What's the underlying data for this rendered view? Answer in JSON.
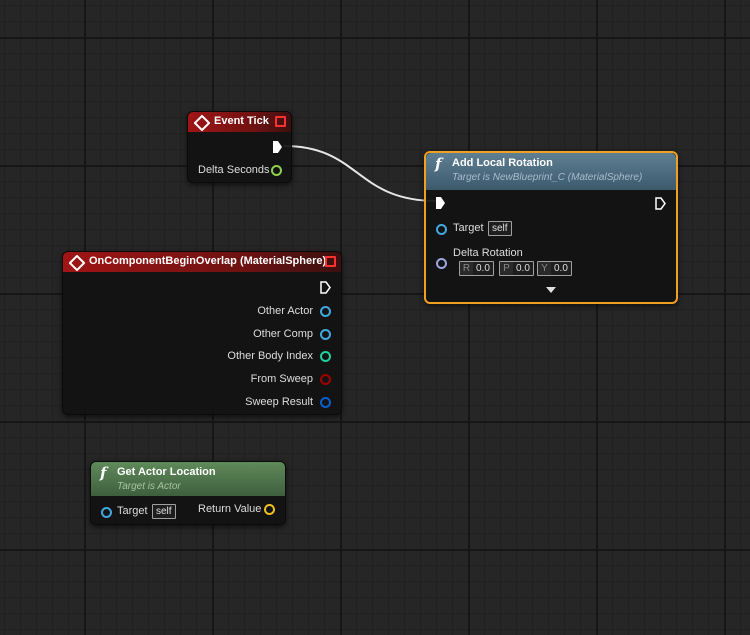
{
  "event_tick": {
    "title": "Event Tick",
    "pin_delta_seconds": "Delta Seconds"
  },
  "overlap": {
    "title": "OnComponentBeginOverlap (MaterialSphere)",
    "pins": [
      "Other Actor",
      "Other Comp",
      "Other Body Index",
      "From Sweep",
      "Sweep Result"
    ]
  },
  "add_rotation": {
    "title": "Add Local Rotation",
    "subtitle": "Target is NewBlueprint_C (MaterialSphere)",
    "target_label": "Target",
    "target_value": "self",
    "delta_label": "Delta Rotation",
    "r_axis": "R",
    "r_value": "0.0",
    "p_axis": "P",
    "p_value": "0.0",
    "y_axis": "Y",
    "y_value": "0.0"
  },
  "get_location": {
    "title": "Get Actor Location",
    "subtitle": "Target is Actor",
    "target_label": "Target",
    "target_value": "self",
    "return_label": "Return Value"
  },
  "colors": {
    "event_header": "#a01515",
    "function_header": "#3d5a6d",
    "pure_header": "#3f5f3d",
    "selection": "#f0a020",
    "object_pin": "#3fa9e0",
    "float_pin": "#8fd14f",
    "int_pin": "#1fd0a0",
    "bool_pin": "#a00000",
    "struct_pin": "#0a5fd0",
    "rotator_pin": "#9aa6e0",
    "vector_pin": "#f0c020"
  }
}
